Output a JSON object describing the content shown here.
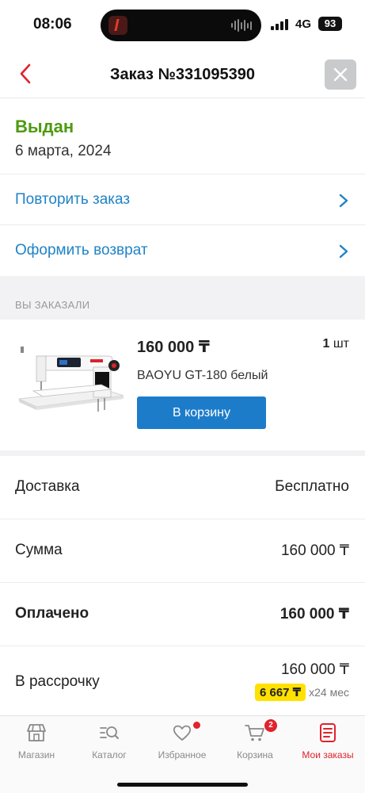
{
  "status_bar": {
    "time": "08:06",
    "network": "4G",
    "battery": "93"
  },
  "header": {
    "title": "Заказ №331095390"
  },
  "order": {
    "status": "Выдан",
    "date": "6 марта, 2024"
  },
  "actions": [
    {
      "label": "Повторить заказ"
    },
    {
      "label": "Оформить возврат"
    }
  ],
  "section_label": "ВЫ ЗАКАЗАЛИ",
  "product": {
    "price": "160 000 ₸",
    "qty_number": "1",
    "qty_unit": "шт",
    "name": "BAOYU GT-180 белый",
    "cart_button": "В корзину"
  },
  "summary": {
    "delivery_label": "Доставка",
    "delivery_value": "Бесплатно",
    "sum_label": "Сумма",
    "sum_value": "160 000 ₸",
    "paid_label": "Оплачено",
    "paid_value": "160 000 ₸",
    "installment_label": "В рассрочку",
    "installment_value": "160 000 ₸",
    "installment_monthly": "6 667 ₸",
    "installment_term": "х24 мес"
  },
  "nav": {
    "items": [
      {
        "label": "Магазин",
        "icon": "shop-icon"
      },
      {
        "label": "Каталог",
        "icon": "catalog-icon"
      },
      {
        "label": "Избранное",
        "icon": "heart-icon"
      },
      {
        "label": "Корзина",
        "icon": "cart-icon",
        "badge": "2"
      },
      {
        "label": "Мои заказы",
        "icon": "orders-icon"
      }
    ]
  },
  "colors": {
    "accent_blue": "#1f83c5",
    "button_blue": "#1d7cca",
    "status_green": "#4e9a12",
    "active_red": "#e0232c",
    "installment_yellow": "#ffe100"
  }
}
